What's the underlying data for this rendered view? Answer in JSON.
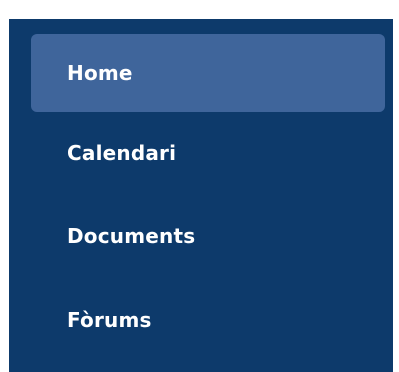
{
  "nav": {
    "items": [
      {
        "label": "Home",
        "active": true
      },
      {
        "label": "Calendari",
        "active": false
      },
      {
        "label": "Documents",
        "active": false
      },
      {
        "label": "Fòrums",
        "active": false
      }
    ]
  },
  "colors": {
    "panel_background": "#0d3a6b",
    "active_item_background": "#3f659b",
    "text": "#ffffff",
    "page_background": "#ffffff"
  }
}
